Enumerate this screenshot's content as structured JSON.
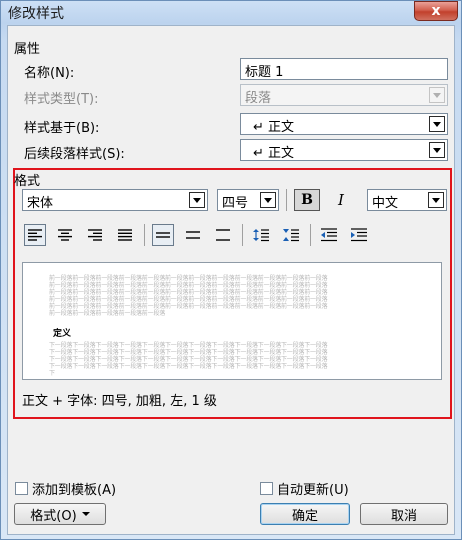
{
  "window": {
    "title": "修改样式",
    "close_glyph": "x"
  },
  "properties": {
    "section_label": "属性",
    "name_label": "名称(N):",
    "name_value": "标题 1",
    "style_type_label": "样式类型(T):",
    "style_type_value": "段落",
    "based_on_label": "样式基于(B):",
    "based_on_value": "↵ 正文",
    "next_style_label": "后续段落样式(S):",
    "next_style_value": "↵ 正文"
  },
  "format": {
    "section_label": "格式",
    "font_value": "宋体",
    "size_value": "四号",
    "bold_label": "B",
    "italic_label": "I",
    "script_value": "中文",
    "icons": [
      "align-left-icon",
      "align-center-icon",
      "align-right-icon",
      "align-justify-icon",
      "line-spacing-single-icon",
      "line-spacing-1_5-icon",
      "line-spacing-double-icon",
      "space-before-increase-icon",
      "space-before-decrease-icon",
      "indent-decrease-icon",
      "indent-increase-icon"
    ]
  },
  "preview": {
    "gray_line": "前一段落前一段落前一段落前一段落前一段落前一段落前一段落前一段落前一段落前一段落前一段落前一段落",
    "gray_line_short": "前一段落前一段落前一段落前一段落前一段落",
    "sample_text": "定义",
    "after_line": "下一段落下一段落下一段落下一段落下一段落下一段落下一段落下一段落下一段落下一段落下一段落下一段落",
    "after_line_last": "下"
  },
  "description": "正文 + 字体: 四号, 加粗, 左, 1 级",
  "footer": {
    "add_to_template_label": "添加到模板(A)",
    "auto_update_label": "自动更新(U)",
    "format_button_label": "格式(O)",
    "ok_label": "确定",
    "cancel_label": "取消"
  },
  "colors": {
    "highlight_border": "#e0141c",
    "title_close": "#c2402c"
  }
}
